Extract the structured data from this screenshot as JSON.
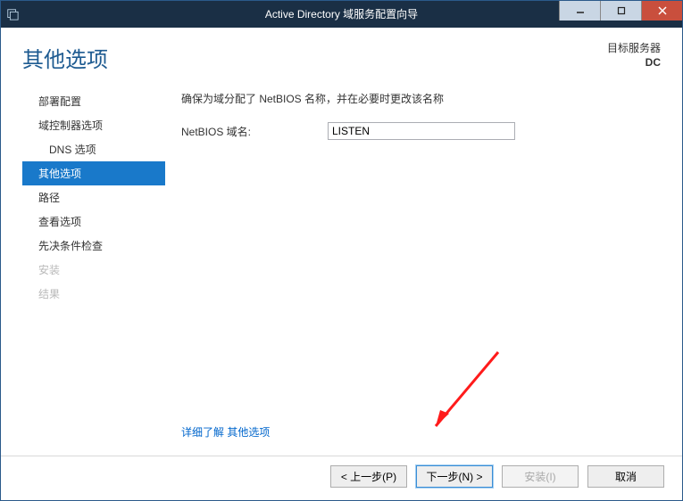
{
  "window": {
    "title": "Active Directory 域服务配置向导"
  },
  "header": {
    "page_title": "其他选项",
    "target_label": "目标服务器",
    "target_name": "DC"
  },
  "nav": {
    "items": [
      {
        "label": "部署配置",
        "state": "normal"
      },
      {
        "label": "域控制器选项",
        "state": "normal"
      },
      {
        "label": "DNS 选项",
        "state": "sub"
      },
      {
        "label": "其他选项",
        "state": "current"
      },
      {
        "label": "路径",
        "state": "normal"
      },
      {
        "label": "查看选项",
        "state": "normal"
      },
      {
        "label": "先决条件检查",
        "state": "normal"
      },
      {
        "label": "安装",
        "state": "disabled"
      },
      {
        "label": "结果",
        "state": "disabled"
      }
    ]
  },
  "main": {
    "description": "确保为域分配了 NetBIOS 名称，并在必要时更改该名称",
    "field_label": "NetBIOS 域名:",
    "field_value": "LISTEN",
    "more_link": "详细了解 其他选项"
  },
  "footer": {
    "prev": "< 上一步(P)",
    "next": "下一步(N) >",
    "install": "安装(I)",
    "cancel": "取消"
  }
}
